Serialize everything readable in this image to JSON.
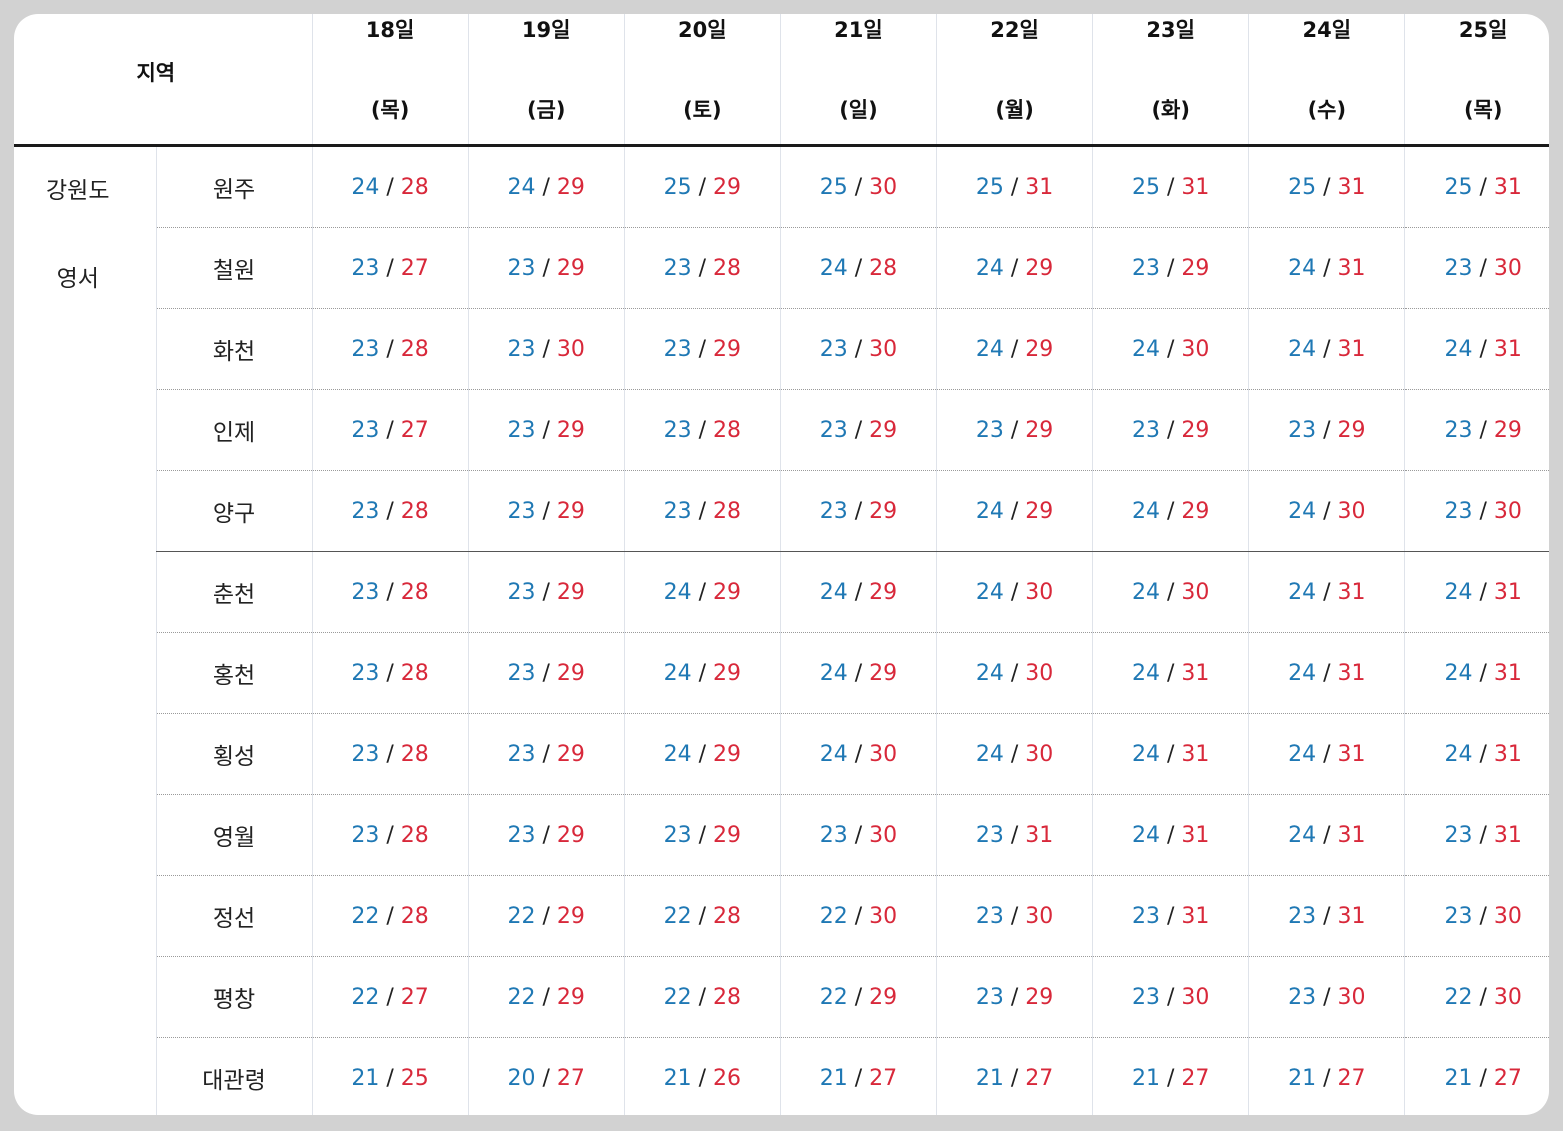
{
  "header": {
    "region_label": "지역",
    "days": [
      {
        "date": "18일",
        "dow": "(목)"
      },
      {
        "date": "19일",
        "dow": "(금)"
      },
      {
        "date": "20일",
        "dow": "(토)"
      },
      {
        "date": "21일",
        "dow": "(일)"
      },
      {
        "date": "22일",
        "dow": "(월)"
      },
      {
        "date": "23일",
        "dow": "(화)"
      },
      {
        "date": "24일",
        "dow": "(수)"
      },
      {
        "date": "25일",
        "dow": "(목)"
      }
    ]
  },
  "province": {
    "line1": "강원도",
    "line2": "영서"
  },
  "separator": "/",
  "colors": {
    "low": "#1f78b4",
    "high": "#d8283a",
    "header_rule": "#1a1a1a"
  },
  "rows": [
    {
      "city": "원주",
      "temps": [
        {
          "lo": "24",
          "hi": "28"
        },
        {
          "lo": "24",
          "hi": "29"
        },
        {
          "lo": "25",
          "hi": "29"
        },
        {
          "lo": "25",
          "hi": "30"
        },
        {
          "lo": "25",
          "hi": "31"
        },
        {
          "lo": "25",
          "hi": "31"
        },
        {
          "lo": "25",
          "hi": "31"
        },
        {
          "lo": "25",
          "hi": "31"
        }
      ]
    },
    {
      "city": "철원",
      "temps": [
        {
          "lo": "23",
          "hi": "27"
        },
        {
          "lo": "23",
          "hi": "29"
        },
        {
          "lo": "23",
          "hi": "28"
        },
        {
          "lo": "24",
          "hi": "28"
        },
        {
          "lo": "24",
          "hi": "29"
        },
        {
          "lo": "23",
          "hi": "29"
        },
        {
          "lo": "24",
          "hi": "31"
        },
        {
          "lo": "23",
          "hi": "30"
        }
      ]
    },
    {
      "city": "화천",
      "temps": [
        {
          "lo": "23",
          "hi": "28"
        },
        {
          "lo": "23",
          "hi": "30"
        },
        {
          "lo": "23",
          "hi": "29"
        },
        {
          "lo": "23",
          "hi": "30"
        },
        {
          "lo": "24",
          "hi": "29"
        },
        {
          "lo": "24",
          "hi": "30"
        },
        {
          "lo": "24",
          "hi": "31"
        },
        {
          "lo": "24",
          "hi": "31"
        }
      ]
    },
    {
      "city": "인제",
      "temps": [
        {
          "lo": "23",
          "hi": "27"
        },
        {
          "lo": "23",
          "hi": "29"
        },
        {
          "lo": "23",
          "hi": "28"
        },
        {
          "lo": "23",
          "hi": "29"
        },
        {
          "lo": "23",
          "hi": "29"
        },
        {
          "lo": "23",
          "hi": "29"
        },
        {
          "lo": "23",
          "hi": "29"
        },
        {
          "lo": "23",
          "hi": "29"
        }
      ]
    },
    {
      "city": "양구",
      "temps": [
        {
          "lo": "23",
          "hi": "28"
        },
        {
          "lo": "23",
          "hi": "29"
        },
        {
          "lo": "23",
          "hi": "28"
        },
        {
          "lo": "23",
          "hi": "29"
        },
        {
          "lo": "24",
          "hi": "29"
        },
        {
          "lo": "24",
          "hi": "29"
        },
        {
          "lo": "24",
          "hi": "30"
        },
        {
          "lo": "23",
          "hi": "30"
        }
      ]
    },
    {
      "city": "춘천",
      "temps": [
        {
          "lo": "23",
          "hi": "28"
        },
        {
          "lo": "23",
          "hi": "29"
        },
        {
          "lo": "24",
          "hi": "29"
        },
        {
          "lo": "24",
          "hi": "29"
        },
        {
          "lo": "24",
          "hi": "30"
        },
        {
          "lo": "24",
          "hi": "30"
        },
        {
          "lo": "24",
          "hi": "31"
        },
        {
          "lo": "24",
          "hi": "31"
        }
      ]
    },
    {
      "city": "홍천",
      "temps": [
        {
          "lo": "23",
          "hi": "28"
        },
        {
          "lo": "23",
          "hi": "29"
        },
        {
          "lo": "24",
          "hi": "29"
        },
        {
          "lo": "24",
          "hi": "29"
        },
        {
          "lo": "24",
          "hi": "30"
        },
        {
          "lo": "24",
          "hi": "31"
        },
        {
          "lo": "24",
          "hi": "31"
        },
        {
          "lo": "24",
          "hi": "31"
        }
      ]
    },
    {
      "city": "횡성",
      "temps": [
        {
          "lo": "23",
          "hi": "28"
        },
        {
          "lo": "23",
          "hi": "29"
        },
        {
          "lo": "24",
          "hi": "29"
        },
        {
          "lo": "24",
          "hi": "30"
        },
        {
          "lo": "24",
          "hi": "30"
        },
        {
          "lo": "24",
          "hi": "31"
        },
        {
          "lo": "24",
          "hi": "31"
        },
        {
          "lo": "24",
          "hi": "31"
        }
      ]
    },
    {
      "city": "영월",
      "temps": [
        {
          "lo": "23",
          "hi": "28"
        },
        {
          "lo": "23",
          "hi": "29"
        },
        {
          "lo": "23",
          "hi": "29"
        },
        {
          "lo": "23",
          "hi": "30"
        },
        {
          "lo": "23",
          "hi": "31"
        },
        {
          "lo": "24",
          "hi": "31"
        },
        {
          "lo": "24",
          "hi": "31"
        },
        {
          "lo": "23",
          "hi": "31"
        }
      ]
    },
    {
      "city": "정선",
      "temps": [
        {
          "lo": "22",
          "hi": "28"
        },
        {
          "lo": "22",
          "hi": "29"
        },
        {
          "lo": "22",
          "hi": "28"
        },
        {
          "lo": "22",
          "hi": "30"
        },
        {
          "lo": "23",
          "hi": "30"
        },
        {
          "lo": "23",
          "hi": "31"
        },
        {
          "lo": "23",
          "hi": "31"
        },
        {
          "lo": "23",
          "hi": "30"
        }
      ]
    },
    {
      "city": "평창",
      "temps": [
        {
          "lo": "22",
          "hi": "27"
        },
        {
          "lo": "22",
          "hi": "29"
        },
        {
          "lo": "22",
          "hi": "28"
        },
        {
          "lo": "22",
          "hi": "29"
        },
        {
          "lo": "23",
          "hi": "29"
        },
        {
          "lo": "23",
          "hi": "30"
        },
        {
          "lo": "23",
          "hi": "30"
        },
        {
          "lo": "22",
          "hi": "30"
        }
      ]
    },
    {
      "city": "대관령",
      "temps": [
        {
          "lo": "21",
          "hi": "25"
        },
        {
          "lo": "20",
          "hi": "27"
        },
        {
          "lo": "21",
          "hi": "26"
        },
        {
          "lo": "21",
          "hi": "27"
        },
        {
          "lo": "21",
          "hi": "27"
        },
        {
          "lo": "21",
          "hi": "27"
        },
        {
          "lo": "21",
          "hi": "27"
        },
        {
          "lo": "21",
          "hi": "27"
        }
      ]
    }
  ]
}
